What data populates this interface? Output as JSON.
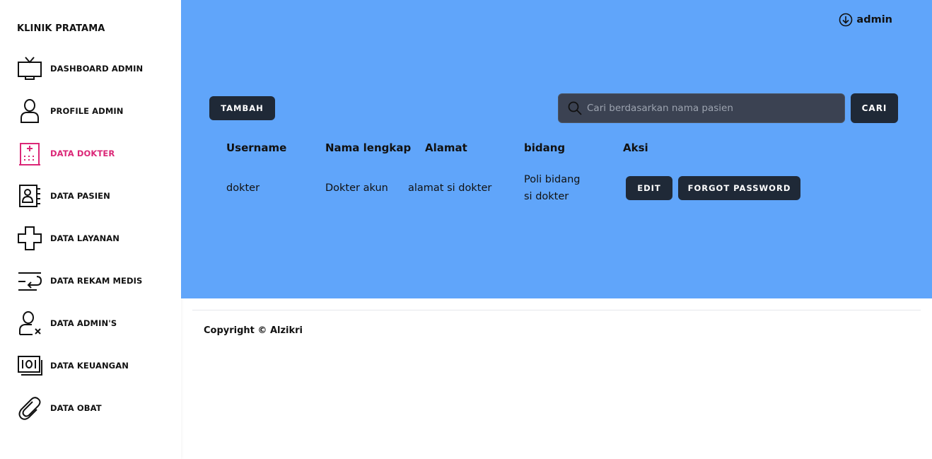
{
  "sidebar": {
    "brand": "KLINIK PRATAMA",
    "active_color": "#db2777",
    "items": [
      {
        "label": "DASHBOARD ADMIN",
        "icon": "tv-icon"
      },
      {
        "label": "PROFILE ADMIN",
        "icon": "user-icon"
      },
      {
        "label": "DATA DOKTER",
        "icon": "hospital-icon",
        "active": true
      },
      {
        "label": "DATA PASIEN",
        "icon": "contact-book-icon"
      },
      {
        "label": "DATA LAYANAN",
        "icon": "medical-cross-icon"
      },
      {
        "label": "DATA REKAM MEDIS",
        "icon": "return-list-icon"
      },
      {
        "label": "DATA ADMIN'S",
        "icon": "user-remove-icon"
      },
      {
        "label": "DATA KEUANGAN",
        "icon": "money-icon"
      },
      {
        "label": "DATA OBAT",
        "icon": "paperclip-icon"
      }
    ]
  },
  "header": {
    "user_name": "admin",
    "user_icon": "circle-arrow-down-icon",
    "background": "#60a5fa"
  },
  "toolbar": {
    "add_label": "TAMBAH",
    "search_placeholder": "Cari berdasarkan nama pasien",
    "search_value": "",
    "search_button": "CARI"
  },
  "table": {
    "headers": [
      "Username",
      "Nama lengkap",
      "Alamat",
      "bidang",
      "Aksi"
    ],
    "rows": [
      {
        "username": "dokter",
        "nama_lengkap": "Dokter akun",
        "alamat": "alamat si dokter",
        "bidang_line1": "Poli bidang",
        "bidang_line2": "si dokter",
        "edit_label": "EDIT",
        "forgot_label": "FORGOT PASSWORD"
      }
    ]
  },
  "footer": {
    "copyright": "Copyright © Alzikri"
  }
}
